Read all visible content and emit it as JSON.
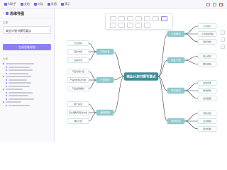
{
  "topbar": {
    "tabs": [
      {
        "label": "AI助手",
        "icon": "assistant-icon"
      },
      {
        "label": "文档",
        "icon": "document-icon"
      },
      {
        "label": "对话",
        "icon": "chat-icon"
      },
      {
        "label": "导图",
        "icon": "mindmap-icon"
      },
      {
        "label": "演示",
        "icon": "slides-icon"
      }
    ]
  },
  "sidebar": {
    "title": "思维导图",
    "topic_label": "主题",
    "topic_value": "商业计划书撰写要点",
    "generate_label": "生成思维导图",
    "outline_label": "大纲"
  },
  "mindmap": {
    "root": "商业计划书撰写要点",
    "left_branches": [
      {
        "label": "市场分析",
        "children": [
          "行业现状",
          "目标市场",
          "竞争对手"
        ]
      },
      {
        "label": "产品服务",
        "children": [
          "产品功能介绍",
          "产品优势特点分析",
          "产品发展规划"
        ]
      },
      {
        "label": "营销策略",
        "children": [
          "推广渠道",
          "定价策略与盈利方式",
          "销售计划"
        ]
      }
    ],
    "right_branches": [
      {
        "label": "公司概况",
        "children": [
          "公司简介",
          "公司发展历程",
          "组织架构"
        ]
      },
      {
        "label": "团队介绍",
        "children": [
          "核心成员",
          "团队优势"
        ]
      },
      {
        "label": "财务规划",
        "children": [
          "资金需求",
          "财务预测",
          "投资回报"
        ]
      },
      {
        "label": "风险控制",
        "children": [
          "风险识别",
          "应对措施",
          "退出机制"
        ]
      }
    ]
  },
  "colors": {
    "accent": "#8b7ff7",
    "root_fill": "#3f8e99",
    "branch_fill": "#8fc9cf",
    "leaf_border": "#9ecfd4",
    "edge": "#3b3b3b"
  }
}
